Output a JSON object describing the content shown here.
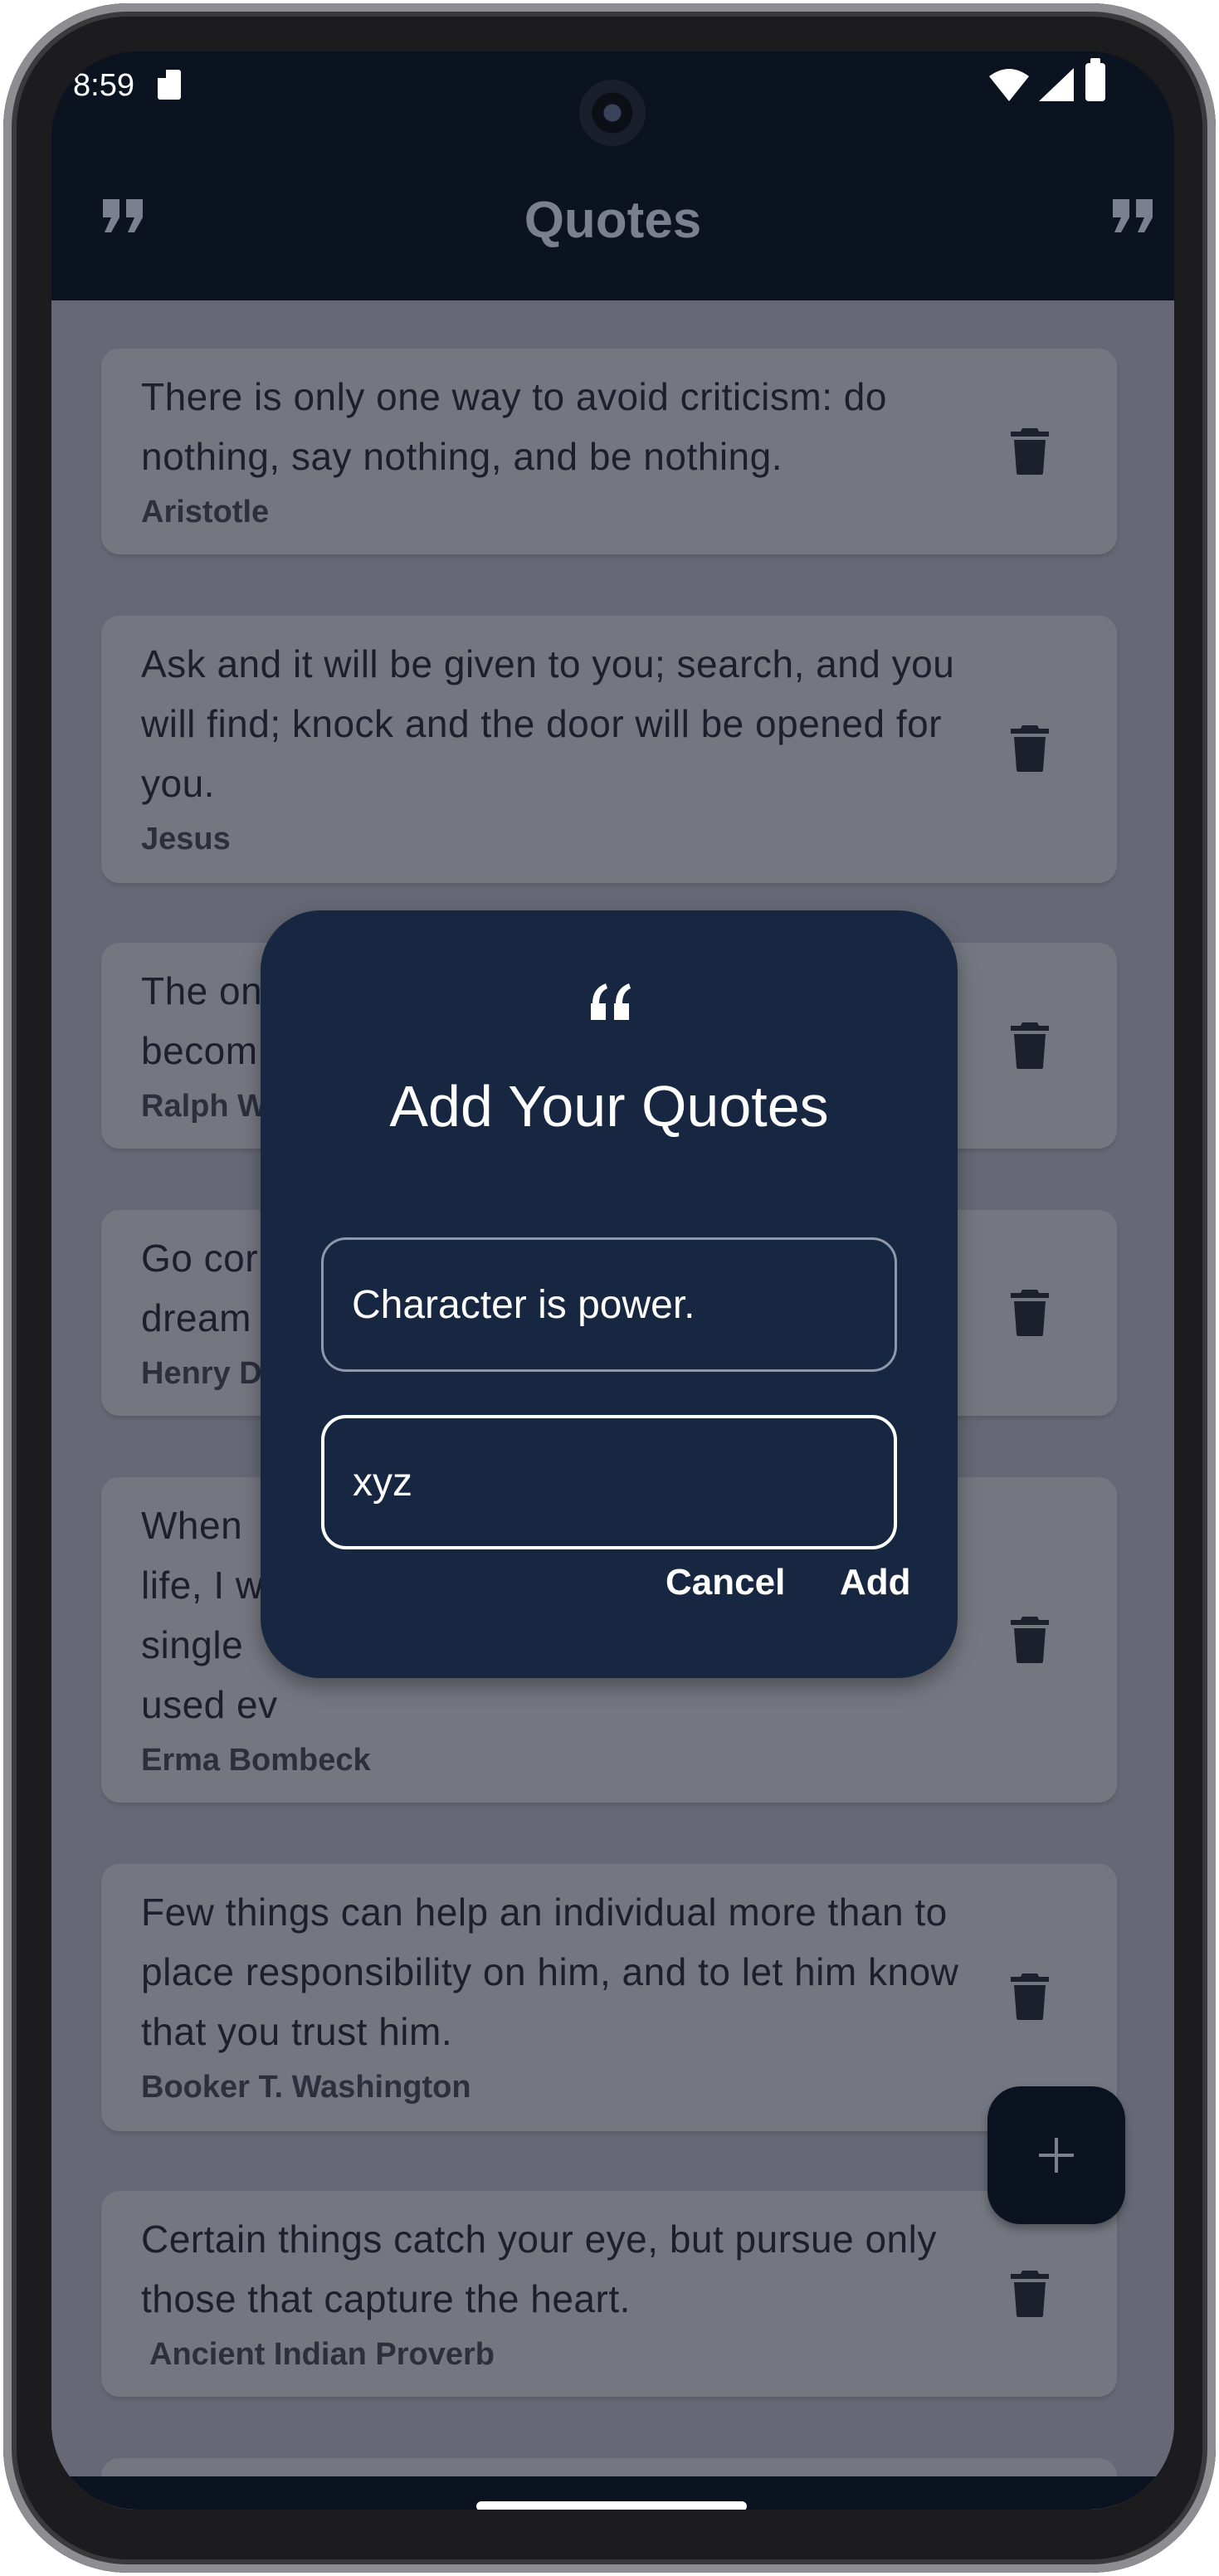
{
  "status_bar": {
    "time": "8:59"
  },
  "app_bar": {
    "title": "Quotes"
  },
  "quotes": [
    {
      "text": "There is only one way to avoid criticism: do nothing, say nothing, and be nothing.",
      "author": "Aristotle"
    },
    {
      "text": "Ask and it will be given to you; search, and you will find; knock and the door will be opened for you.",
      "author": "Jesus"
    },
    {
      "text": "The onl",
      "text2": "becom",
      "author": "Ralph W"
    },
    {
      "text": "Go cor",
      "text2": "dream",
      "author": "Henry D"
    },
    {
      "text": "When",
      "text2": "life, I w",
      "text3": "single",
      "text4": "used ev",
      "author": "Erma Bombeck"
    },
    {
      "text": "Few things can help an individual more than to place responsibility on him, and to let him know that you trust him.",
      "author": "Booker T. Washington"
    },
    {
      "text": "Certain things catch your eye, but pursue only those that capture the heart.",
      "author": "Ancient Indian Proverb"
    }
  ],
  "dialog": {
    "title": "Add Your Quotes",
    "quote_value": "Character is power.",
    "author_value": "xyz",
    "cancel_label": "Cancel",
    "add_label": "Add"
  },
  "colors": {
    "app_bar": "#0b1220",
    "dialog_bg": "#172641",
    "card_bg": "#d6d8e3",
    "fab": "#0b1220"
  }
}
